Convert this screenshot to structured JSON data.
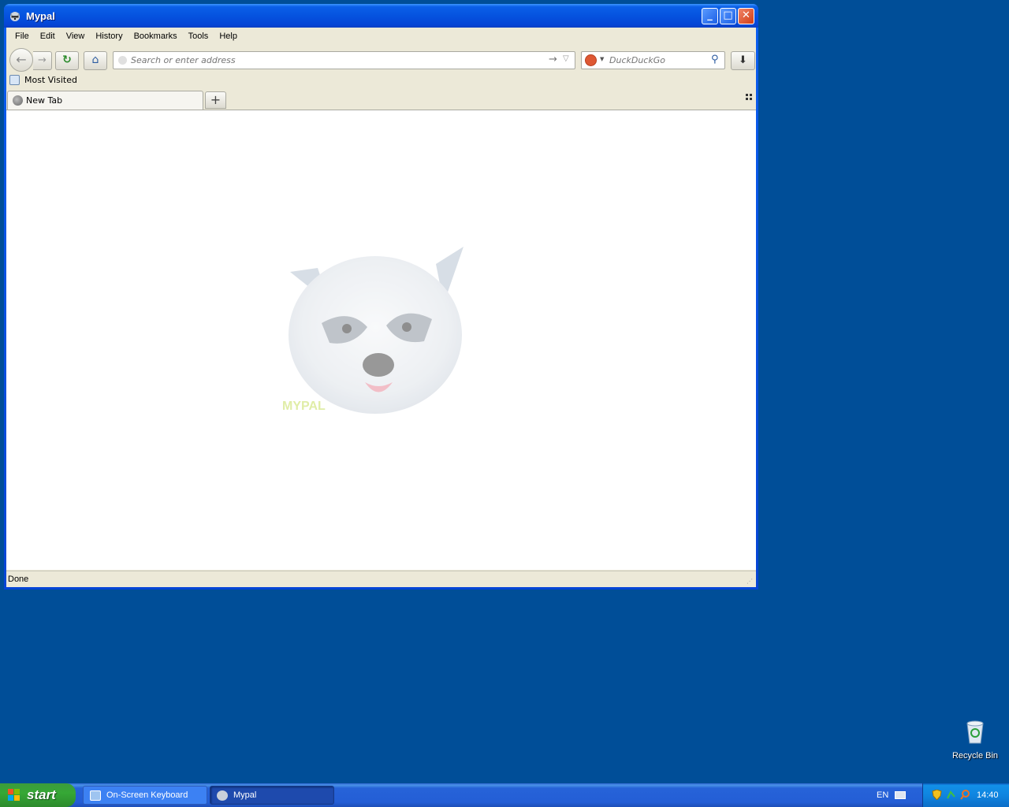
{
  "window": {
    "title": "Mypal",
    "minimize_label": "_",
    "maximize_label": "□",
    "close_label": "✕"
  },
  "menu": {
    "items": [
      "File",
      "Edit",
      "View",
      "History",
      "Bookmarks",
      "Tools",
      "Help"
    ]
  },
  "navbar": {
    "back_glyph": "←",
    "forward_glyph": "→",
    "reload_glyph": "↻",
    "home_glyph": "⌂",
    "url_placeholder": "Search or enter address",
    "url_value": "",
    "go_glyph": "→",
    "dropdown_glyph": "▽",
    "search_placeholder": "DuckDuckGo",
    "search_engine": "DuckDuckGo",
    "search_glyph": "⚲",
    "download_glyph": "⬇"
  },
  "bookmarks": {
    "items": [
      {
        "label": "Most Visited"
      }
    ]
  },
  "tabs": {
    "items": [
      {
        "label": "New Tab",
        "active": true
      }
    ],
    "new_tab_glyph": "+",
    "list_glyph": "▪▪"
  },
  "content": {
    "logo": "raccoon-logo",
    "logo_caption": "MYPAL"
  },
  "status": {
    "text": "Done"
  },
  "desktop": {
    "icons": [
      {
        "label": "Recycle Bin"
      }
    ]
  },
  "taskbar": {
    "start_label": "start",
    "tasks": [
      {
        "label": "On-Screen Keyboard",
        "active": false
      },
      {
        "label": "Mypal",
        "active": true
      }
    ],
    "language": "EN",
    "clock": "14:40"
  },
  "colors": {
    "desktop": "#004e98",
    "titlebar": "#0553df",
    "chrome": "#ece9d8",
    "start": "#36a836",
    "taskbar": "#245ed6"
  }
}
